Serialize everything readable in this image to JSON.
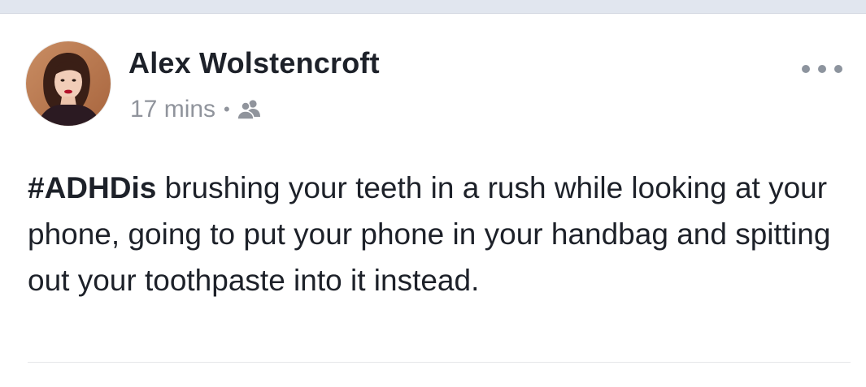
{
  "post": {
    "author": {
      "name": "Alex Wolstencroft",
      "avatar": "profile-photo"
    },
    "timestamp": "17 mins",
    "separator": "•",
    "audience_icon": "friends-icon",
    "more_icon": "more-options-icon",
    "hashtag": "#ADHDis",
    "body": " brushing your teeth in a rush while looking at your phone, going to put your phone in your handbag and spitting out your toothpaste into it instead."
  },
  "colors": {
    "text": "#1d2129",
    "meta": "#90949c",
    "top_strip": "#e1e6ef"
  }
}
